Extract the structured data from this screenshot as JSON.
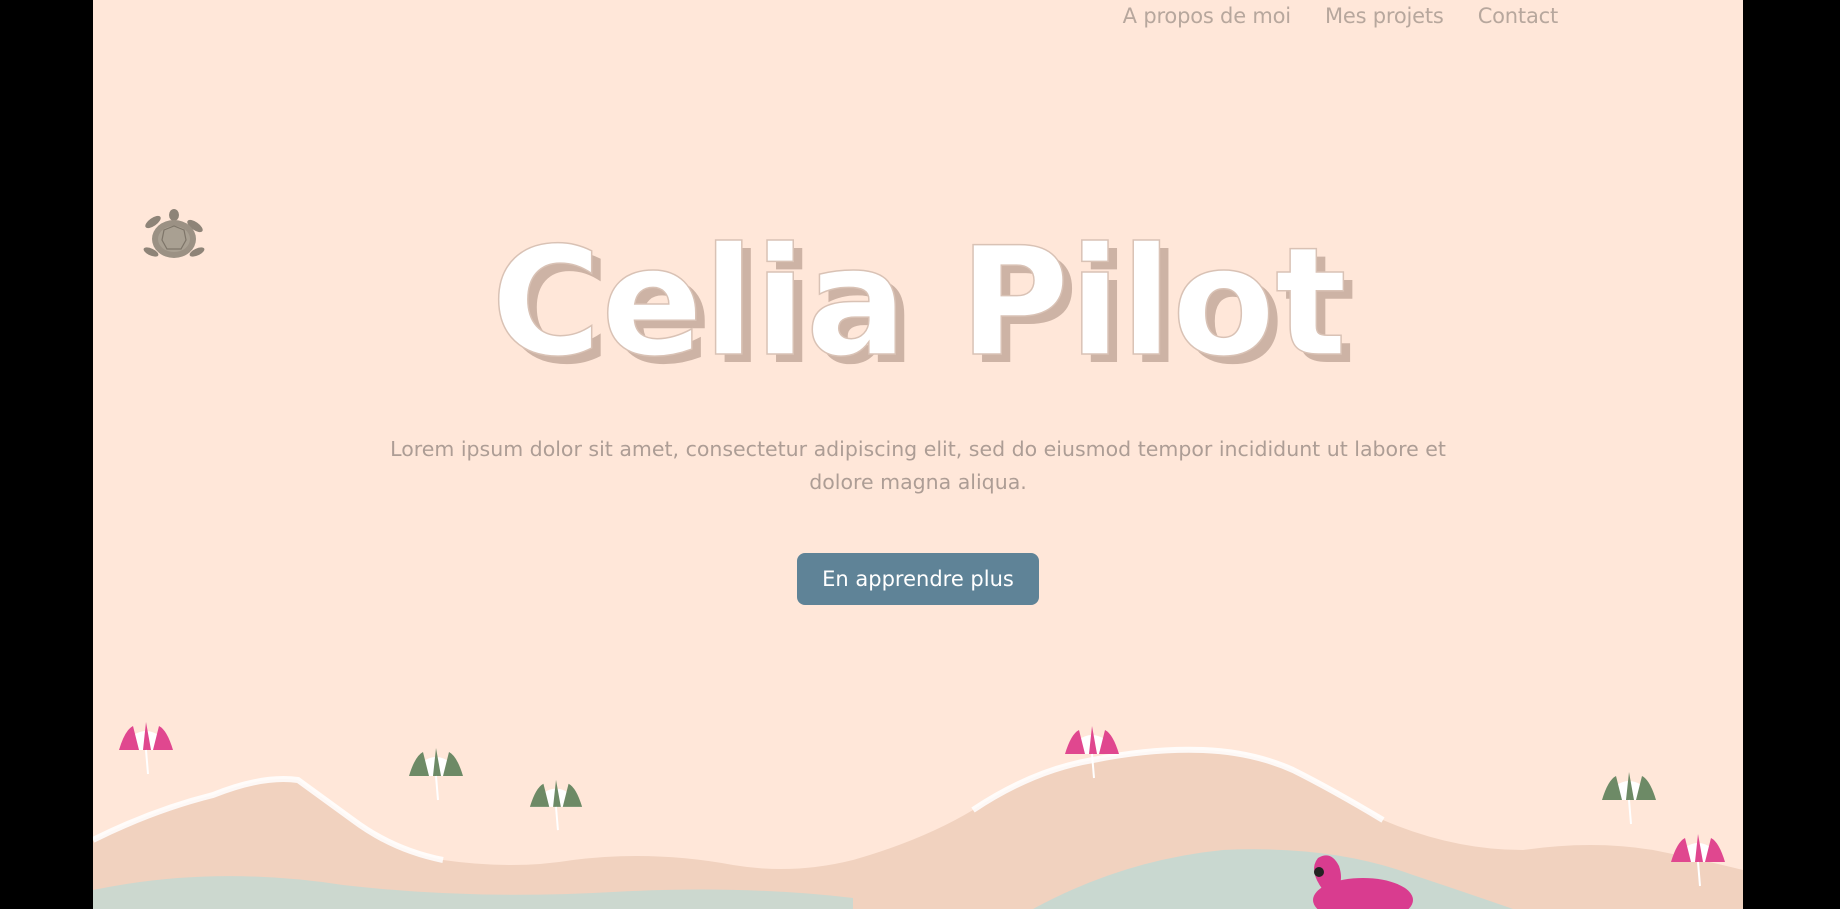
{
  "nav": {
    "items": [
      {
        "label": "A propos de moi"
      },
      {
        "label": "Mes projets"
      },
      {
        "label": "Contact"
      }
    ]
  },
  "hero": {
    "title": "Celia Pilot",
    "subtitle": "Lorem ipsum dolor sit amet, consectetur adipiscing elit, sed do eiusmod  tempor incididunt ut labore et dolore magna aliqua.",
    "cta_label": "En apprendre plus"
  },
  "colors": {
    "background": "#ffe7d9",
    "frame": "#000000",
    "nav_text": "#b7a79d",
    "subtitle_text": "#ad9d95",
    "button": "#5f8397",
    "title_fill": "#ffffff",
    "title_shadow": "#cdb3a5",
    "umbrella_pink": "#e0478f",
    "umbrella_green": "#6d8a66",
    "sand": "#f1d2bf",
    "water": "#bfd9d4"
  },
  "icons": {
    "turtle": "turtle-icon",
    "umbrella": "beach-umbrella-icon",
    "flamingo_float": "flamingo-float-icon"
  }
}
